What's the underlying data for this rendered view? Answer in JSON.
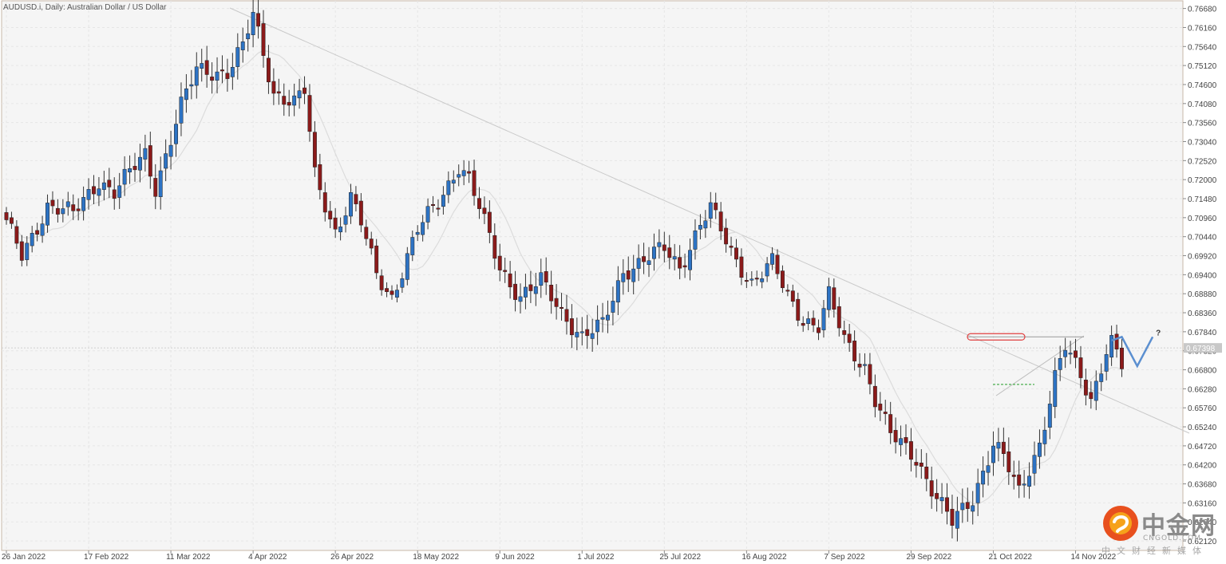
{
  "chart_data": {
    "type": "candlestick",
    "title": "AUDUSD.i, Daily:  Australian Dollar / US Dollar",
    "ylim": [
      0.6186,
      0.7689
    ],
    "y_ticks": [
      "0.76680",
      "0.76160",
      "0.75640",
      "0.75120",
      "0.74600",
      "0.74080",
      "0.73560",
      "0.73040",
      "0.72520",
      "0.72000",
      "0.71480",
      "0.70960",
      "0.70440",
      "0.69920",
      "0.69400",
      "0.68880",
      "0.68360",
      "0.67840",
      "0.67320",
      "0.66800",
      "0.66280",
      "0.65760",
      "0.65240",
      "0.64720",
      "0.64200",
      "0.63680",
      "0.63160",
      "0.62640",
      "0.62120"
    ],
    "current_price": "0.67398",
    "x_ticks": [
      {
        "label": "26 Jan 2022",
        "bar": 0
      },
      {
        "label": "17 Feb 2022",
        "bar": 16
      },
      {
        "label": "11 Mar 2022",
        "bar": 32
      },
      {
        "label": "4 Apr 2022",
        "bar": 48
      },
      {
        "label": "26 Apr 2022",
        "bar": 64
      },
      {
        "label": "18 May 2022",
        "bar": 80
      },
      {
        "label": "9 Jun 2022",
        "bar": 96
      },
      {
        "label": "1 Jul 2022",
        "bar": 112
      },
      {
        "label": "25 Jul 2022",
        "bar": 128
      },
      {
        "label": "16 Aug 2022",
        "bar": 144
      },
      {
        "label": "7 Sep 2022",
        "bar": 160
      },
      {
        "label": "29 Sep 2022",
        "bar": 176
      },
      {
        "label": "21 Oct 2022",
        "bar": 192
      },
      {
        "label": "14 Nov 2022",
        "bar": 208
      }
    ],
    "anchors": [
      [
        0,
        0.708
      ],
      [
        3,
        0.699
      ],
      [
        8,
        0.713
      ],
      [
        13,
        0.7105
      ],
      [
        18,
        0.72
      ],
      [
        21,
        0.7165
      ],
      [
        27,
        0.727
      ],
      [
        29,
        0.718
      ],
      [
        34,
        0.74
      ],
      [
        37,
        0.75
      ],
      [
        43,
        0.7495
      ],
      [
        46,
        0.756
      ],
      [
        48,
        0.765
      ],
      [
        52,
        0.744
      ],
      [
        56,
        0.741
      ],
      [
        58,
        0.744
      ],
      [
        60,
        0.721
      ],
      [
        64,
        0.706
      ],
      [
        67,
        0.715
      ],
      [
        69,
        0.708
      ],
      [
        72,
        0.694
      ],
      [
        75,
        0.688
      ],
      [
        80,
        0.706
      ],
      [
        84,
        0.714
      ],
      [
        88,
        0.724
      ],
      [
        90,
        0.72
      ],
      [
        96,
        0.696
      ],
      [
        100,
        0.688
      ],
      [
        104,
        0.692
      ],
      [
        108,
        0.684
      ],
      [
        112,
        0.677
      ],
      [
        116,
        0.68
      ],
      [
        120,
        0.695
      ],
      [
        124,
        0.698
      ],
      [
        128,
        0.701
      ],
      [
        131,
        0.696
      ],
      [
        135,
        0.708
      ],
      [
        137,
        0.712
      ],
      [
        141,
        0.7
      ],
      [
        145,
        0.692
      ],
      [
        149,
        0.697
      ],
      [
        152,
        0.688
      ],
      [
        155,
        0.682
      ],
      [
        158,
        0.68
      ],
      [
        160,
        0.688
      ],
      [
        163,
        0.676
      ],
      [
        167,
        0.669
      ],
      [
        169,
        0.66
      ],
      [
        172,
        0.65
      ],
      [
        177,
        0.644
      ],
      [
        181,
        0.633
      ],
      [
        184,
        0.626
      ],
      [
        188,
        0.633
      ],
      [
        192,
        0.648
      ],
      [
        194,
        0.644
      ],
      [
        197,
        0.634
      ],
      [
        201,
        0.648
      ],
      [
        204,
        0.666
      ],
      [
        206,
        0.674
      ],
      [
        209,
        0.666
      ],
      [
        211,
        0.66
      ],
      [
        214,
        0.674
      ],
      [
        215,
        0.676
      ],
      [
        217,
        0.669
      ]
    ],
    "overlay": {
      "resistance_level": 0.677,
      "support_level": 0.664,
      "projected_path": [
        [
          215,
          0.676
        ],
        [
          217,
          0.677
        ],
        [
          220,
          0.669
        ],
        [
          223,
          0.677
        ]
      ],
      "question_mark": "?"
    }
  },
  "watermark": {
    "name": "中金网",
    "url": "CNGOLD.COM",
    "tagline": "中文财经新媒体"
  }
}
